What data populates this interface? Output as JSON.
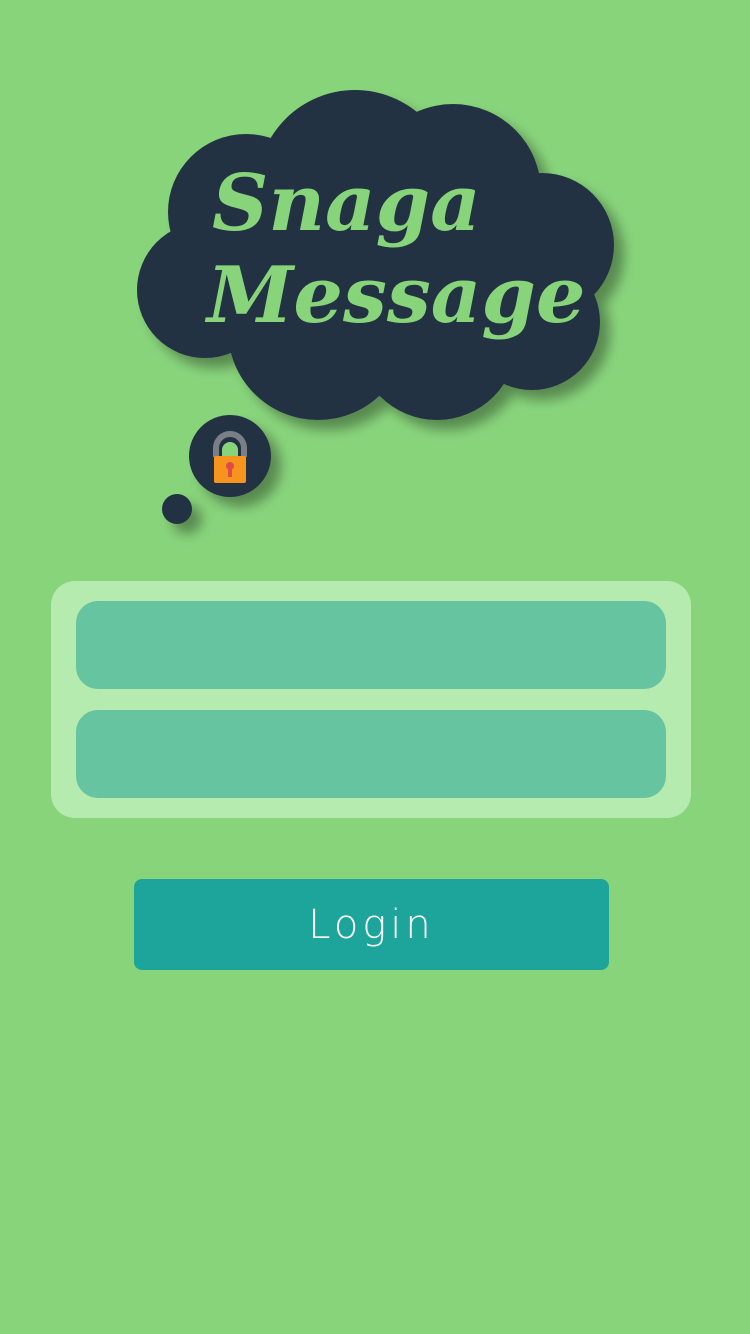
{
  "app": {
    "title_line1": "Snaga",
    "title_line2": "Message"
  },
  "icons": {
    "logo": "thought-cloud-logo",
    "lock": "padlock-icon"
  },
  "form": {
    "username_value": "",
    "username_placeholder": "",
    "password_value": "",
    "password_placeholder": ""
  },
  "actions": {
    "login_label": "Login"
  },
  "colors": {
    "background": "#88d47b",
    "cloud": "#223142",
    "title_text": "#88d47b",
    "form_card": "#b5ebae",
    "field": "#67c4a0",
    "button": "#1da59c",
    "lock_body": "#f7941d",
    "lock_shackle": "#7a7f87",
    "keyhole": "#e24a4a"
  }
}
